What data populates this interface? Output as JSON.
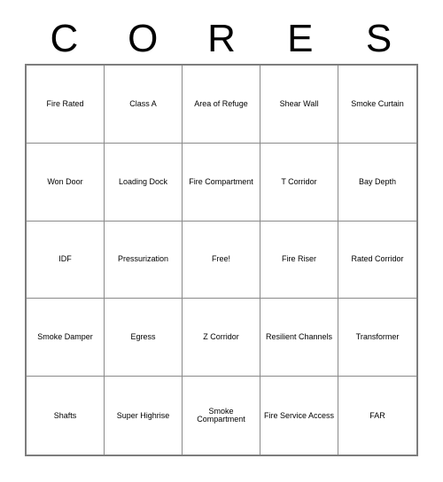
{
  "card": {
    "header_letters": [
      "C",
      "O",
      "R",
      "E",
      "S"
    ],
    "rows": [
      [
        {
          "label": "Fire Rated"
        },
        {
          "label": "Class A"
        },
        {
          "label": "Area of Refuge"
        },
        {
          "label": "Shear Wall"
        },
        {
          "label": "Smoke Curtain"
        }
      ],
      [
        {
          "label": "Won Door"
        },
        {
          "label": "Loading Dock"
        },
        {
          "label": "Fire Compartment"
        },
        {
          "label": "T Corridor"
        },
        {
          "label": "Bay Depth"
        }
      ],
      [
        {
          "label": "IDF"
        },
        {
          "label": "Pressurization"
        },
        {
          "label": "Free!"
        },
        {
          "label": "Fire Riser"
        },
        {
          "label": "Rated Corridor"
        }
      ],
      [
        {
          "label": "Smoke Damper"
        },
        {
          "label": "Egress"
        },
        {
          "label": "Z Corridor"
        },
        {
          "label": "Resilient Channels"
        },
        {
          "label": "Transformer"
        }
      ],
      [
        {
          "label": "Shafts"
        },
        {
          "label": "Super Highrise"
        },
        {
          "label": "Smoke Compartment"
        },
        {
          "label": "Fire Service Access"
        },
        {
          "label": "FAR"
        }
      ]
    ],
    "free_space_label": "Free!",
    "colors": {
      "text": "#000000",
      "grid_line": "#8a8a8a",
      "border": "#7d7d7d",
      "background": "#ffffff"
    }
  }
}
